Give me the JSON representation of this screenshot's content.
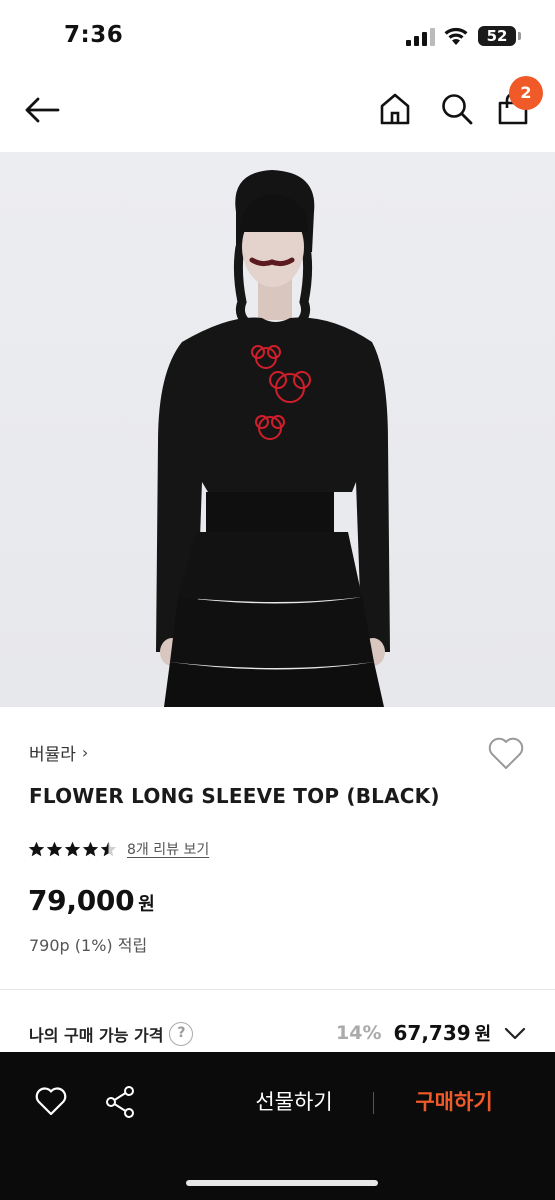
{
  "status_bar": {
    "time": "7:36",
    "battery": "52"
  },
  "header": {
    "cart_count": "2"
  },
  "product": {
    "brand": "버뮬라",
    "brand_chevron": "›",
    "title": "FLOWER LONG SLEEVE TOP (BLACK)",
    "rating": 4.5,
    "review_link": "8개 리뷰 보기",
    "price": "79,000",
    "price_unit": "원",
    "points": "790p (1%) 적립"
  },
  "my_price": {
    "label": "나의 구매 가능 가격",
    "help_glyph": "?",
    "discount": "14%",
    "value": "67,739",
    "unit": "원"
  },
  "bottom_bar": {
    "gift_label": "선물하기",
    "buy_label": "구매하기"
  },
  "colors": {
    "accent": "#f05a28",
    "bottom_bar": "#0b0b0b"
  },
  "icons": [
    "arrow-left-icon",
    "home-icon",
    "search-icon",
    "shopping-bag-icon",
    "heart-icon",
    "star-icon",
    "help-icon",
    "chevron-down-icon",
    "share-icon"
  ]
}
